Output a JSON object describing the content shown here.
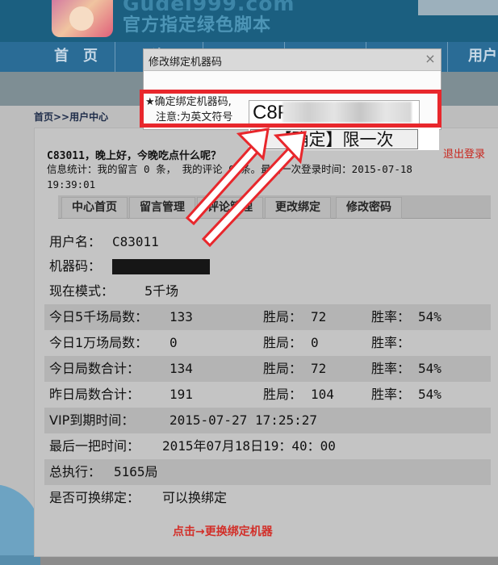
{
  "header": {
    "site_name": "Gudel999.com",
    "slogan": "官方指定绿色脚本"
  },
  "nav": {
    "items": [
      "首　页",
      "资",
      "",
      "",
      "",
      "用户"
    ]
  },
  "breadcrumb": "首页>>用户中心",
  "welcome": "C83011，晚上好，今晚吃点什么呢？",
  "stats_line": "信息统计：我的留言 0 条， 我的评论 0 条。最后一次登录时间：2015-07-18 19:39:01",
  "logout": "退出登录",
  "tabs": [
    "中心首页",
    "留言管理",
    "评论管理",
    "更改绑定",
    "修改密码"
  ],
  "info": {
    "username_label": "用户名：",
    "username": "C83011",
    "machine_label": "机器码：",
    "mode_label": "现在模式：",
    "mode": "5千场",
    "rows": [
      {
        "label": "今日5千场局数：",
        "count": "133",
        "wins_label": "胜局：",
        "wins": "72",
        "rate_label": "胜率：",
        "rate": "54%"
      },
      {
        "label": "今日1万场局数：",
        "count": "0",
        "wins_label": "胜局：",
        "wins": "0",
        "rate_label": "胜率：",
        "rate": ""
      },
      {
        "label": "今日局数合计：",
        "count": "134",
        "wins_label": "胜局：",
        "wins": "72",
        "rate_label": "胜率：",
        "rate": "54%"
      },
      {
        "label": "昨日局数合计：",
        "count": "191",
        "wins_label": "胜局：",
        "wins": "104",
        "rate_label": "胜率：",
        "rate": "54%"
      }
    ],
    "vip_label": "VIP到期时间：",
    "vip": "2015-07-27 17:25:27",
    "last_label": "最后一把时间：",
    "last": "2015年07月18日19：40：00",
    "total_label": "总执行：",
    "total": "5165局",
    "rebind_label": "是否可换绑定：",
    "rebind": "可以换绑定"
  },
  "bottom_link": "点击→更换绑定机器",
  "dialog": {
    "title": "修改绑定机器码",
    "close": "×",
    "label1": "★确定绑定机器码,",
    "label2": "注意:为英文符号",
    "input_value": "C8PJ",
    "confirm": "【确定】限一次"
  },
  "colors": {
    "banner": "#1b5f80",
    "nav": "#2a6c96",
    "highlight_red": "#e8272c",
    "link_red": "#d22f29"
  }
}
